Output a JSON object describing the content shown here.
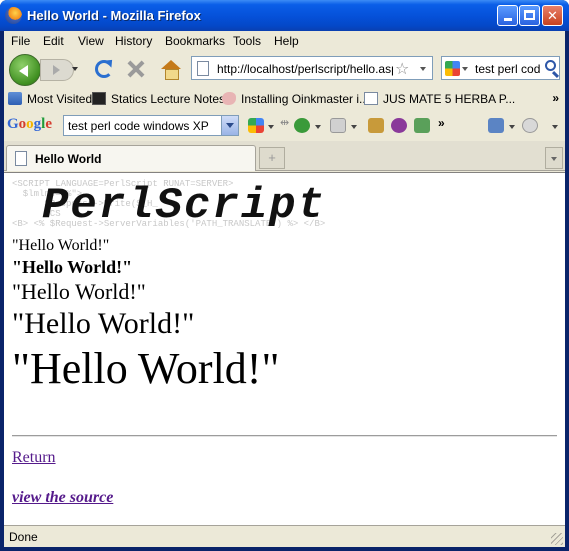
{
  "window": {
    "title": "Hello World - Mozilla Firefox"
  },
  "menu": {
    "items": [
      "File",
      "Edit",
      "View",
      "History",
      "Bookmarks",
      "Tools",
      "Help"
    ]
  },
  "navigation": {
    "url": "http://localhost/perlscript/hello.asp",
    "search_text": "test perl cod"
  },
  "bookmarks": {
    "items": [
      "Most Visited",
      "Statics Lecture Notes",
      "Installing Oinkmaster i...",
      "JUS MATE 5 HERBA P..."
    ],
    "overflow": "»"
  },
  "google_toolbar": {
    "brand": [
      "G",
      "o",
      "o",
      "g",
      "l",
      "e"
    ],
    "query": "test perl code windows XP"
  },
  "tabs": {
    "active_label": "Hello World",
    "new_tab_symbol": "+"
  },
  "page": {
    "banner_logo": "PerlScript",
    "banner_code": "<SCRIPT LANGUAGE=PerlScript RUNAT=SERVER>\n  $lmlnc=\"%\">\n      $Response->Write($_H_\n      ECS\n<B> <% $Request->ServerVariables('PATH_TRANSLATE') %> </B>",
    "hello_lines": [
      "\"Hello World!\"",
      "\"Hello World!\"",
      "\"Hello World!\"",
      "\"Hello World!\"",
      "\"Hello World!\""
    ],
    "return_link": "Return",
    "view_source_link": "view the source"
  },
  "status": {
    "text": "Done"
  },
  "colors": {
    "visited_link": "#551a8b",
    "title_bar": "#0550d8",
    "chrome_bg": "#ece9d8"
  }
}
